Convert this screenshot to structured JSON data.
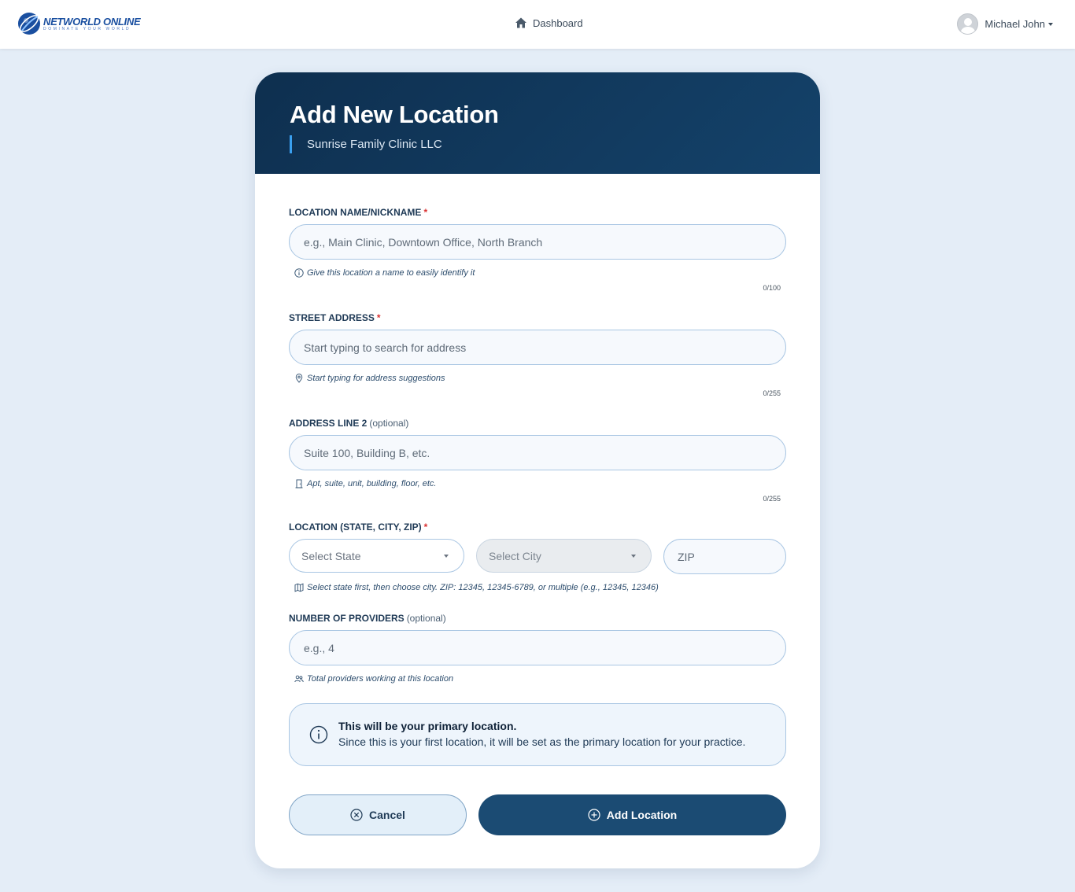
{
  "nav": {
    "brand_name": "NETWORLD ONLINE",
    "brand_tagline": "DOMINATE YOUR WORLD",
    "dashboard_label": "Dashboard",
    "user_name": "Michael John"
  },
  "header": {
    "title": "Add New Location",
    "subtitle": "Sunrise Family Clinic LLC"
  },
  "fields": {
    "location_name": {
      "label": "LOCATION NAME/NICKNAME",
      "required_mark": "*",
      "placeholder": "e.g., Main Clinic, Downtown Office, North Branch",
      "hint": "Give this location a name to easily identify it",
      "counter": "0/100"
    },
    "street_address": {
      "label": "STREET ADDRESS",
      "required_mark": "*",
      "placeholder": "Start typing to search for address",
      "hint": "Start typing for address suggestions",
      "counter": "0/255"
    },
    "address_line2": {
      "label": "ADDRESS LINE 2",
      "optional_text": "(optional)",
      "placeholder": "Suite 100, Building B, etc.",
      "hint": "Apt, suite, unit, building, floor, etc.",
      "counter": "0/255"
    },
    "location": {
      "label": "LOCATION (STATE, CITY, ZIP)",
      "required_mark": "*",
      "state_placeholder": "Select State",
      "city_placeholder": "Select City",
      "zip_placeholder": "ZIP",
      "hint": "Select state first, then choose city. ZIP: 12345, 12345-6789, or multiple (e.g., 12345, 12346)"
    },
    "providers": {
      "label": "NUMBER OF PROVIDERS",
      "optional_text": "(optional)",
      "placeholder": "e.g., 4",
      "hint": "Total providers working at this location"
    }
  },
  "notice": {
    "title": "This will be your primary location.",
    "text": "Since this is your first location, it will be set as the primary location for your practice."
  },
  "actions": {
    "cancel_label": "Cancel",
    "add_label": "Add Location"
  },
  "colors": {
    "header_bg": "#0e2f4f",
    "primary_button": "#1b4b73",
    "accent": "#3aa0f0",
    "required": "#d93030",
    "page_bg": "#e4edf7"
  }
}
